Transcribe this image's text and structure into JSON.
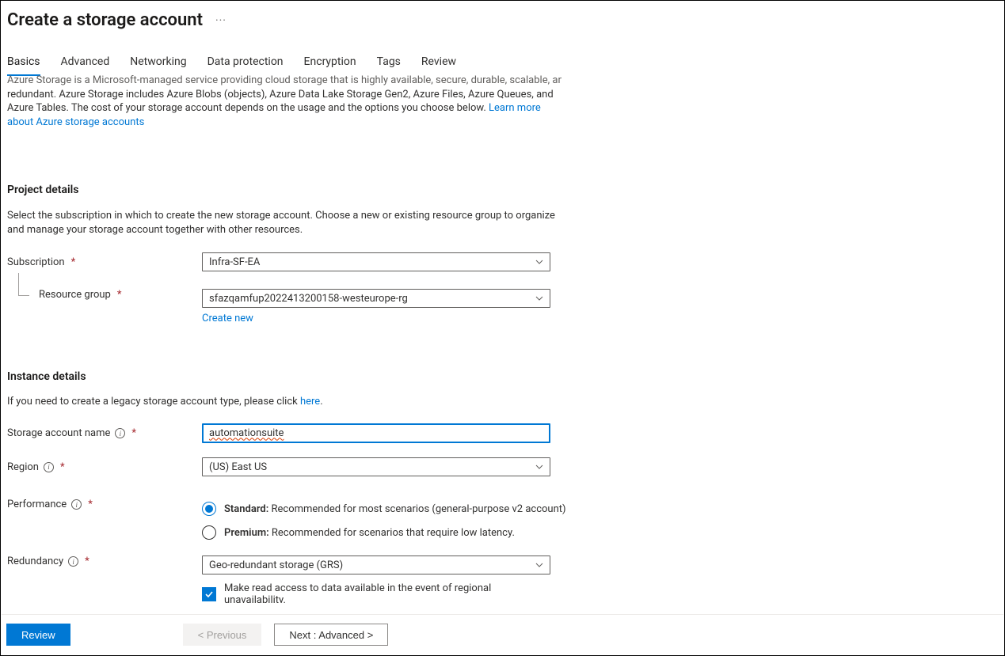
{
  "header": {
    "title": "Create a storage account"
  },
  "tabs": {
    "basics": "Basics",
    "advanced": "Advanced",
    "networking": "Networking",
    "data_protection": "Data protection",
    "encryption": "Encryption",
    "tags": "Tags",
    "review": "Review"
  },
  "intro": {
    "clipped_first_line": "Azure Storage is a Microsoft-managed service providing cloud storage that is highly available, secure, durable, scalable, and",
    "line2": "redundant. Azure Storage includes Azure Blobs (objects), Azure Data Lake Storage Gen2, Azure Files, Azure Queues, and Azure Tables. The cost of your storage account depends on the usage and the options you choose below. ",
    "link_text": "Learn more about Azure storage accounts"
  },
  "project": {
    "title": "Project details",
    "desc": "Select the subscription in which to create the new storage account. Choose a new or existing resource group to organize and manage your storage account together with other resources.",
    "subscription_label": "Subscription",
    "subscription_value": "Infra-SF-EA",
    "resource_group_label": "Resource group",
    "resource_group_value": "sfazqamfup2022413200158-westeurope-rg",
    "create_new": "Create new"
  },
  "instance": {
    "title": "Instance details",
    "legacy_text": "If you need to create a legacy storage account type, please click ",
    "legacy_link": "here",
    "name_label": "Storage account name",
    "name_value": "automationsuite",
    "region_label": "Region",
    "region_value": "(US) East US",
    "performance_label": "Performance",
    "perf_standard_bold": "Standard:",
    "perf_standard_text": " Recommended for most scenarios (general-purpose v2 account)",
    "perf_premium_bold": "Premium:",
    "perf_premium_text": " Recommended for scenarios that require low latency.",
    "redundancy_label": "Redundancy",
    "redundancy_value": "Geo-redundant storage (GRS)",
    "read_access_checkbox": "Make read access to data available in the event of regional unavailability."
  },
  "footer": {
    "review": "Review",
    "previous": "< Previous",
    "next": "Next : Advanced >"
  }
}
